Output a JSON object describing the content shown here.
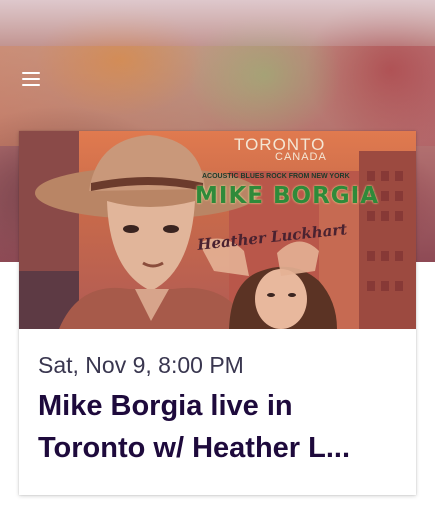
{
  "header": {
    "menu_icon": "hamburger-menu-icon"
  },
  "event": {
    "poster": {
      "city": "TORONTO",
      "country": "CANADA",
      "tagline": "ACOUSTIC BLUES ROCK FROM NEW YORK",
      "artist": "MIKE BORGIA",
      "guest": "Heather Luckhart"
    },
    "date": "Sat, Nov 9, 8:00 PM",
    "title_line1": "Mike Borgia live in",
    "title_line2": "Toronto w/ Heather L..."
  }
}
